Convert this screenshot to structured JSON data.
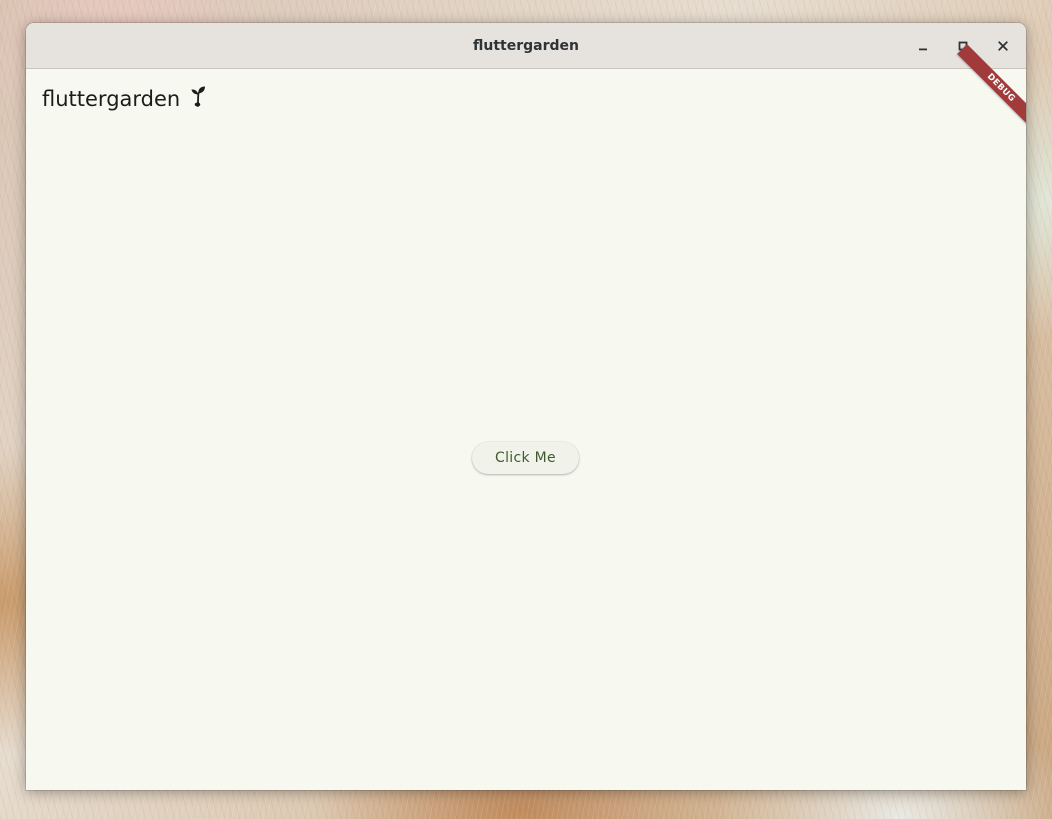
{
  "window": {
    "title": "fluttergarden",
    "controls": {
      "minimize_icon": "minimize-icon",
      "maximize_icon": "maximize-icon",
      "close_icon": "close-icon"
    }
  },
  "app": {
    "title": "fluttergarden",
    "title_icon": "sprout-icon",
    "button_label": "Click Me",
    "debug_banner": "DEBUG"
  },
  "colors": {
    "background": "#f7f9f1",
    "titlebar": "#e6e3df",
    "button_text": "#3f5b2e",
    "debug_banner": "#a13b3b"
  }
}
